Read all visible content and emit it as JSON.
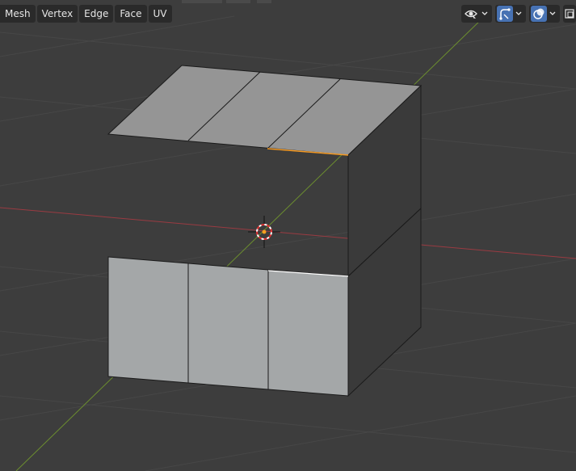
{
  "header": {
    "menus": [
      {
        "label": "Mesh"
      },
      {
        "label": "Vertex"
      },
      {
        "label": "Edge"
      },
      {
        "label": "Face"
      },
      {
        "label": "UV"
      }
    ]
  },
  "colors": {
    "background": "#3d3d3d",
    "grid_line": "#474747",
    "x_axis": "#9a3b42",
    "y_axis": "#6c8e2f",
    "face_top": "#959595",
    "face_front": "#a4a7a8",
    "face_dark": "#3a3a3a",
    "edge": "#1a1a1a",
    "selected_edge": "#f59a23",
    "accent": "#4772b3"
  },
  "tools": {
    "icons": [
      "eye-selectability-icon",
      "gizmo-icon",
      "overlay-icon"
    ]
  }
}
